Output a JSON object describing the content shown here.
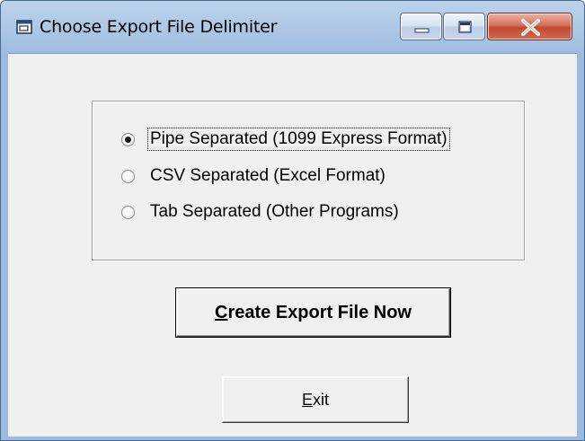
{
  "window": {
    "title": "Choose Export File Delimiter",
    "icon": "application-icon"
  },
  "caption_buttons": {
    "minimize_icon": "minimize-icon",
    "maximize_icon": "maximize-icon",
    "close_icon": "close-icon"
  },
  "delimiter_options": [
    {
      "label": "Pipe Separated (1099 Express Format)",
      "checked": true,
      "focused": true
    },
    {
      "label": "CSV Separated (Excel Format)",
      "checked": false,
      "focused": false
    },
    {
      "label": "Tab  Separated (Other Programs)",
      "checked": false,
      "focused": false
    }
  ],
  "buttons": {
    "create_accel": "C",
    "create_rest": "reate Export File Now",
    "exit_accel": "E",
    "exit_rest": "xit"
  },
  "colors": {
    "dialog_face": "#f0f0f0",
    "title_bar": "#a9c4e3",
    "close_button": "#c04a30"
  }
}
